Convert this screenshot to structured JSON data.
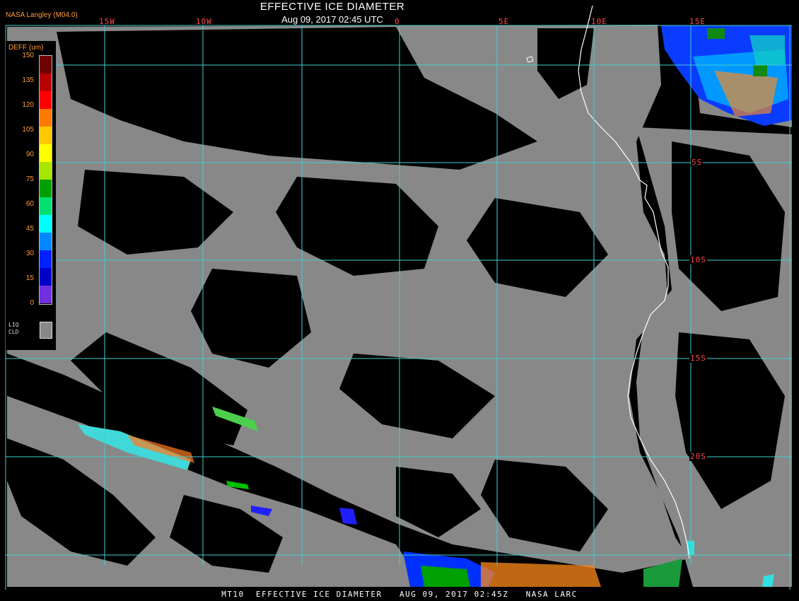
{
  "header": {
    "title": "EFFECTIVE ICE DIAMETER",
    "subtitle": "Aug 09, 2017 02:45 UTC",
    "org": "NASA Langley (M04.0)"
  },
  "longitude_labels": [
    "15W",
    "10W",
    "0",
    "5E",
    "10E",
    "15E"
  ],
  "latitude_labels": [
    "5S",
    "10S",
    "15S",
    "20S"
  ],
  "legend": {
    "title": "DEFF (um)",
    "ticks": [
      "150",
      "135",
      "120",
      "105",
      "90",
      "75",
      "60",
      "45",
      "30",
      "15",
      "0"
    ],
    "colors": [
      "#6e0000",
      "#b80000",
      "#ff0000",
      "#ff7a00",
      "#ffc800",
      "#ffff00",
      "#a6e600",
      "#00a000",
      "#00e070",
      "#00ffff",
      "#0088ff",
      "#0022ff",
      "#0000c8",
      "#7030e0"
    ],
    "liquid_label_1": "LIQ",
    "liquid_label_2": "CLD",
    "liquid_color": "#888888"
  },
  "footer": "MT10  EFFECTIVE ICE DIAMETER   AUG 09, 2017 02:45Z   NASA LARC",
  "colors": {
    "cloud": "#888888",
    "clear": "#000000",
    "grid": "#3fd0d0",
    "coast": "#ffffff"
  }
}
